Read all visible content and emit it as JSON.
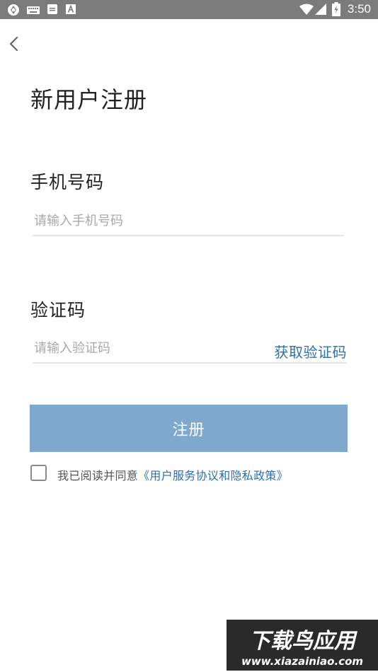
{
  "status_bar": {
    "time": "3:50",
    "left_icons": [
      "sync-icon",
      "keyboard-icon",
      "message-icon",
      "font-a-icon"
    ],
    "right_icons": [
      "wifi-icon",
      "signal-icon",
      "battery-icon"
    ]
  },
  "page": {
    "title": "新用户注册"
  },
  "form": {
    "phone": {
      "label": "手机号码",
      "placeholder": "请输入手机号码"
    },
    "code": {
      "label": "验证码",
      "placeholder": "请输入验证码",
      "get_code": "获取验证码"
    },
    "register_label": "注册",
    "agreement": {
      "prefix": "我已阅读并同意",
      "link": "《用户服务协议和隐私政策》"
    }
  },
  "watermark": {
    "brand": "下载鸟应用",
    "url": "www.xiazainiao.com"
  },
  "colors": {
    "status_bar": "#7b7b7b",
    "accent_link": "#2c6fad",
    "button_disabled": "#7ea8ce",
    "divider": "#e6e6e6"
  }
}
